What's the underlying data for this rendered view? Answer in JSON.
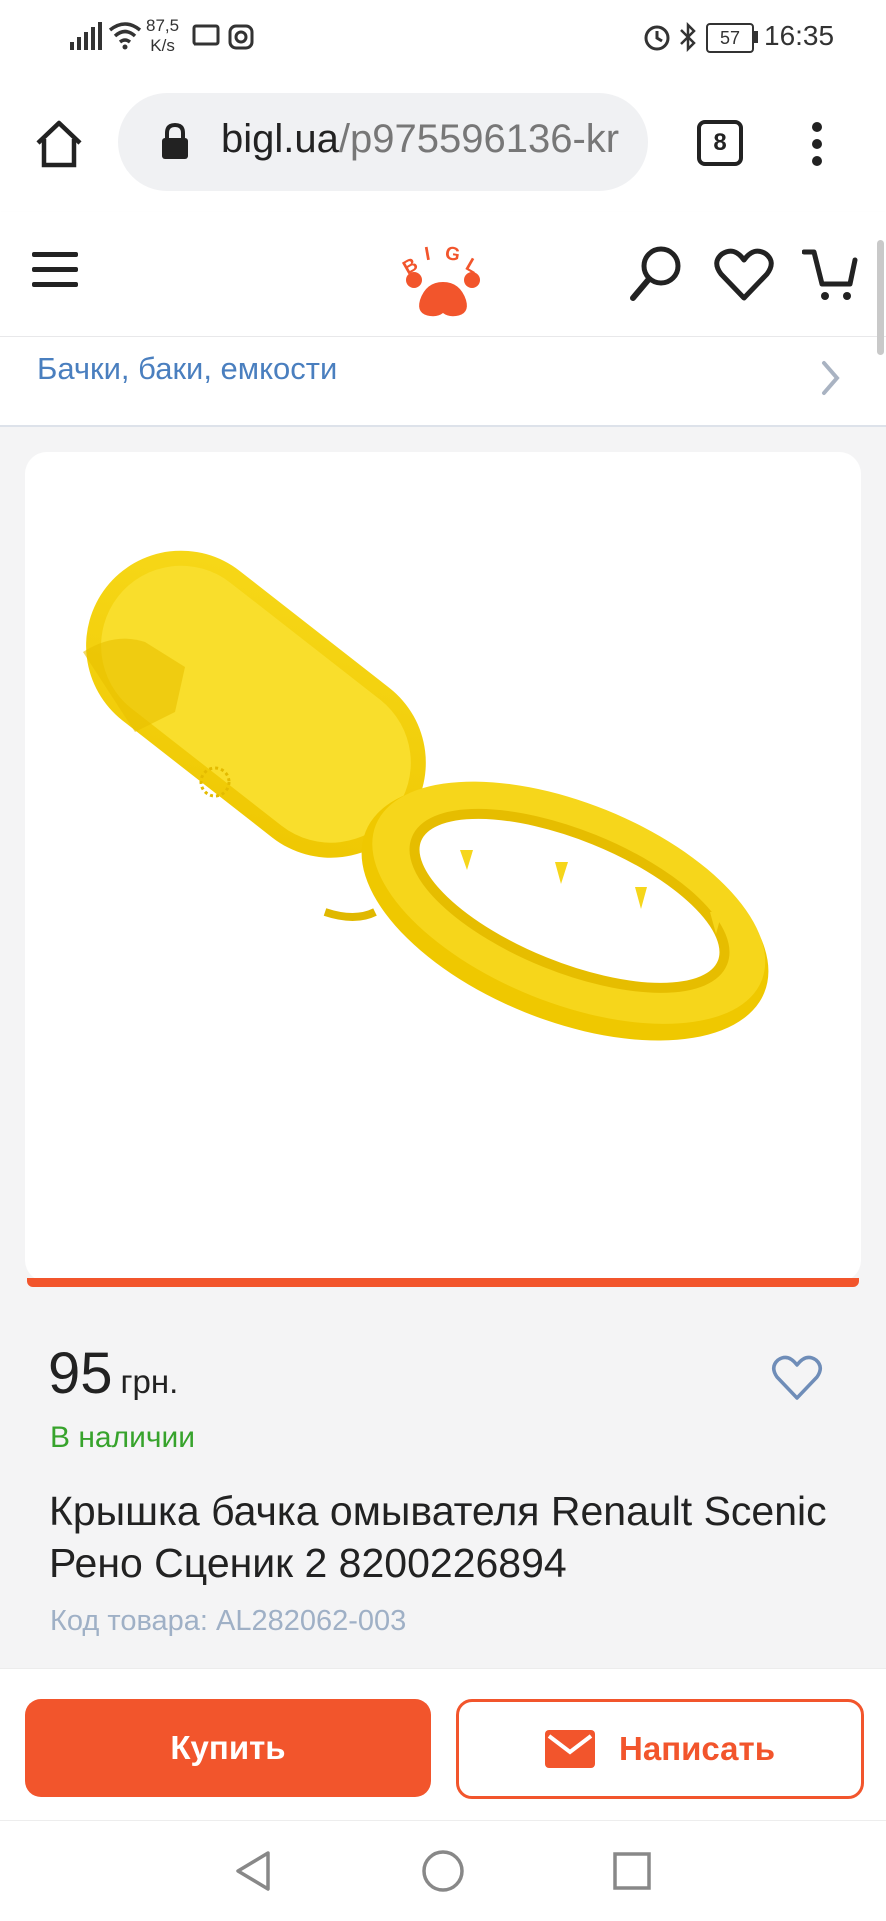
{
  "status_bar": {
    "net_speed_value": "87,5",
    "net_speed_unit": "K/s",
    "battery": "57",
    "time": "16:35"
  },
  "browser": {
    "url_host": "bigl.ua",
    "url_path": "/p975596136-kr",
    "tab_count": "8"
  },
  "header": {
    "logo_letters": [
      "B",
      "I",
      "G",
      "L"
    ]
  },
  "breadcrumb": {
    "label": "Бачки, баки, емкости"
  },
  "product": {
    "price": "95",
    "currency": "грн.",
    "availability": "В наличии",
    "title": "Крышка бачка омывателя Renault Scenic Рено Сценик 2 8200226894",
    "code": "Код товара: AL282062-003"
  },
  "actions": {
    "buy_label": "Купить",
    "write_label": "Написать"
  },
  "colors": {
    "accent": "#f2552c",
    "in_stock": "#37a32c",
    "link": "#4a7fbf",
    "product_yellow": "#f5d40f"
  }
}
